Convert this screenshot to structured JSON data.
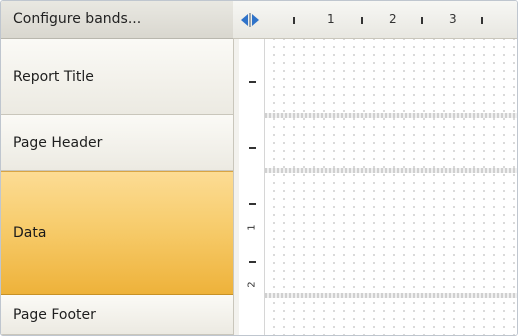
{
  "bands_panel": {
    "configure_label": "Configure bands...",
    "bands": [
      {
        "label": "Report Title",
        "selected": false
      },
      {
        "label": "Page Header",
        "selected": false
      },
      {
        "label": "Data",
        "selected": true
      },
      {
        "label": "Page Footer",
        "selected": false
      }
    ]
  },
  "ruler": {
    "horizontal_labels": [
      "1",
      "2",
      "3"
    ],
    "vertical_labels": [
      "1",
      "2"
    ]
  },
  "colors": {
    "selected_band": "#f7cc6c",
    "arrow_blue": "#2f73c9"
  },
  "icons": {
    "splitter_arrows": "left-right-arrows-icon"
  }
}
